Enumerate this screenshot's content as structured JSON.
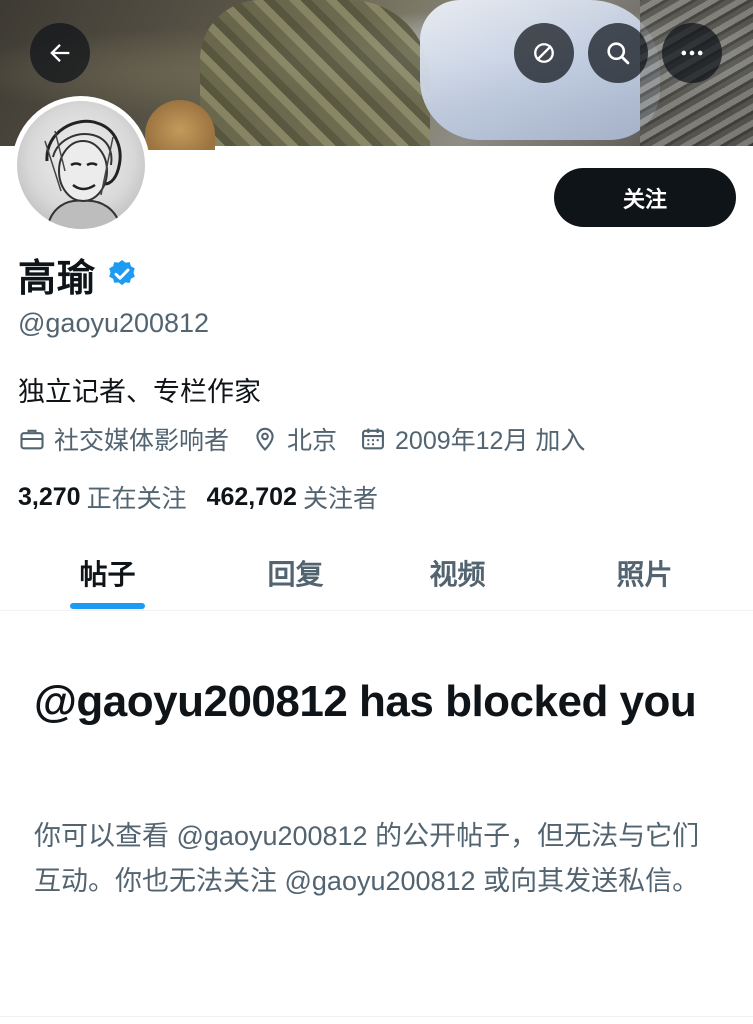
{
  "header": {
    "back_icon": "arrow-left-icon",
    "translate_icon": "translate-icon",
    "search_icon": "search-icon",
    "more_icon": "more-horizontal-icon"
  },
  "profile": {
    "display_name": "高瑜",
    "verified_icon": "verified-badge-icon",
    "verified_color": "#1d9bf0",
    "handle": "@gaoyu200812",
    "follow_label": "关注",
    "bio": "独立记者、专栏作家",
    "meta": {
      "category": "社交媒体影响者",
      "location": "北京",
      "joined": "2009年12月 加入"
    },
    "stats": {
      "following_count": "3,270",
      "following_label": "正在关注",
      "followers_count": "462,702",
      "followers_label": "关注者"
    }
  },
  "tabs": [
    {
      "label": "帖子",
      "active": true
    },
    {
      "label": "回复",
      "active": false
    },
    {
      "label": "视频",
      "active": false
    },
    {
      "label": "照片",
      "active": false
    }
  ],
  "blocked": {
    "title": "@gaoyu200812 has blocked you",
    "description": "你可以查看 @gaoyu200812 的公开帖子，但无法与它们互动。你也无法关注 @gaoyu200812 或向其发送私信。"
  },
  "colors": {
    "accent": "#1d9bf0",
    "text_primary": "#0f1419",
    "text_secondary": "#536471"
  }
}
